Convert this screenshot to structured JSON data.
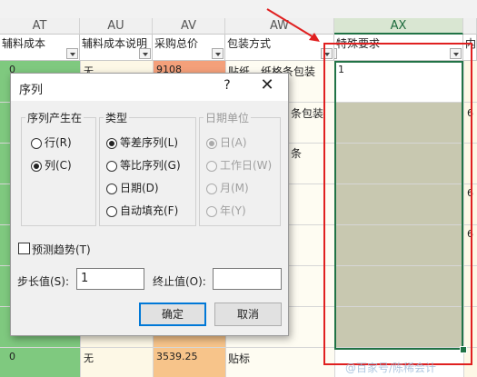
{
  "columns": {
    "letters": [
      "AT",
      "AU",
      "AV",
      "AW",
      "AX"
    ],
    "headers": [
      "辅料成本",
      "辅料成本说明",
      "采购总价",
      "包装方式",
      "特殊要求",
      "内"
    ]
  },
  "cells": {
    "at_row1": "0",
    "au_row1": "无",
    "av_row1": "9108",
    "aw_row1": "贴纸，纸格条包装",
    "ax_row1": "1",
    "aw_row2_frag": "条包装",
    "aw_row3_frag": "条",
    "at_last": "0",
    "au_last": "无",
    "av_last": "3539.25",
    "aw_last": "贴标",
    "ay_frag": "6"
  },
  "watermark": "@百家号/陈稀会计",
  "dialog": {
    "title": "序列",
    "help": "?",
    "close": "✕",
    "series_in": {
      "label": "序列产生在",
      "options": [
        {
          "label": "行(R)",
          "checked": false
        },
        {
          "label": "列(C)",
          "checked": true
        }
      ]
    },
    "type": {
      "label": "类型",
      "options": [
        {
          "label": "等差序列(L)",
          "checked": true
        },
        {
          "label": "等比序列(G)",
          "checked": false
        },
        {
          "label": "日期(D)",
          "checked": false
        },
        {
          "label": "自动填充(F)",
          "checked": false
        }
      ]
    },
    "date_unit": {
      "label": "日期单位",
      "options": [
        {
          "label": "日(A)",
          "checked": true
        },
        {
          "label": "工作日(W)",
          "checked": false
        },
        {
          "label": "月(M)",
          "checked": false
        },
        {
          "label": "年(Y)",
          "checked": false
        }
      ]
    },
    "trend": {
      "label": "预测趋势(T)",
      "checked": false
    },
    "step": {
      "label": "步长值(S):",
      "value": "1"
    },
    "stop": {
      "label": "终止值(O):",
      "value": ""
    },
    "ok": "确定",
    "cancel": "取消"
  },
  "colors": {
    "at_col": "#7fc97f",
    "av_col": "#f7c48a",
    "av_top": "#f4a07a",
    "ax_fill": "#c8c8b0",
    "red_frame": "#e02020",
    "selection": "#217346"
  }
}
